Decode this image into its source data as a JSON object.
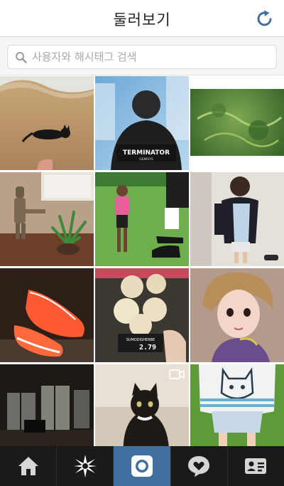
{
  "header": {
    "title": "둘러보기",
    "refresh_icon": "refresh-icon"
  },
  "search": {
    "placeholder": "사용자와 해시태그 검색",
    "value": "",
    "icon": "search-icon"
  },
  "grid": {
    "tiles": [
      {
        "subject": "cat-on-beach"
      },
      {
        "subject": "terminator-jacket",
        "caption": "TERMINATOR",
        "caption_sub": "GENISYS"
      },
      {
        "subject": "green-foliage"
      },
      {
        "subject": "groot-figure-plant"
      },
      {
        "subject": "soccer-players"
      },
      {
        "subject": "mirror-selfie"
      },
      {
        "subject": "orange-sneakers"
      },
      {
        "subject": "onions-market",
        "label_text": "SUMODISHERBE",
        "price": "2.79"
      },
      {
        "subject": "girl-selfie"
      },
      {
        "subject": "dark-room"
      },
      {
        "subject": "kitten",
        "is_video": true
      },
      {
        "subject": "cat-shirt"
      }
    ]
  },
  "tabbar": {
    "active": "camera",
    "tabs": [
      {
        "id": "home",
        "icon": "home-icon"
      },
      {
        "id": "explore",
        "icon": "explore-star-icon"
      },
      {
        "id": "camera",
        "icon": "camera-icon"
      },
      {
        "id": "activity",
        "icon": "heart-bubble-icon"
      },
      {
        "id": "profile",
        "icon": "profile-card-icon"
      }
    ]
  },
  "colors": {
    "active_tab": "#3f6f9c",
    "tabbar": "#1a1a1a",
    "refresh": "#3f6f9c"
  }
}
